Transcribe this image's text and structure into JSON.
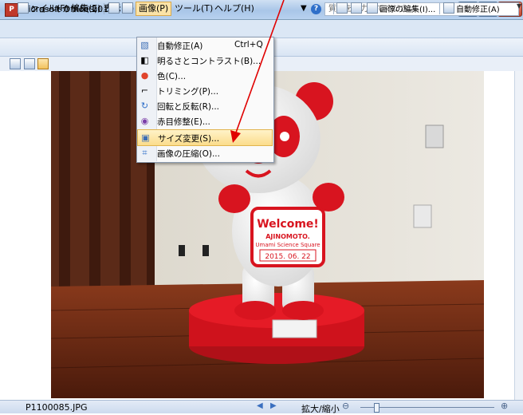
{
  "window": {
    "title": "Microsoft Office 2010",
    "icon": "picture-manager-icon"
  },
  "menu": {
    "items": [
      {
        "label": "ファイル(F)"
      },
      {
        "label": "編集(E)"
      },
      {
        "label": "表示(V)"
      },
      {
        "label": "画像(P)"
      },
      {
        "label": "ツール(T)"
      },
      {
        "label": "ヘルプ(H)"
      }
    ],
    "question_placeholder": "質問を入力してください"
  },
  "toolbar": {
    "shortcut_label": "ショートカット(S)...",
    "edit_pictures_label": "画像の編集(I)...",
    "auto_correct_label": "自動修正(A)"
  },
  "dropdown": {
    "items": [
      {
        "label": "自動修正(A)",
        "shortcut": "Ctrl+Q",
        "icon": "auto-correct-icon"
      },
      {
        "label": "明るさとコントラスト(B)...",
        "icon": "brightness-icon"
      },
      {
        "label": "色(C)...",
        "icon": "color-icon"
      },
      {
        "label": "トリミング(P)...",
        "icon": "crop-icon"
      },
      {
        "label": "回転と反転(R)...",
        "icon": "rotate-icon"
      },
      {
        "label": "赤目修整(E)...",
        "icon": "red-eye-icon"
      },
      {
        "label": "サイズ変更(S)...",
        "icon": "resize-icon",
        "highlighted": true
      },
      {
        "label": "画像の圧縮(O)...",
        "icon": "compress-icon"
      }
    ]
  },
  "photo": {
    "sign_title": "Welcome!",
    "sign_brand": "AJINOMOTO.",
    "sign_sub": "Umami Science Square",
    "sign_date": "2015. 06. 22"
  },
  "statusbar": {
    "filename": "P1100085.JPG",
    "zoom_label": "拡大/縮小"
  },
  "colors": {
    "highlight": "#fbdc8b",
    "annotation_arrow": "#e00000",
    "panda_red": "#d8141f"
  }
}
